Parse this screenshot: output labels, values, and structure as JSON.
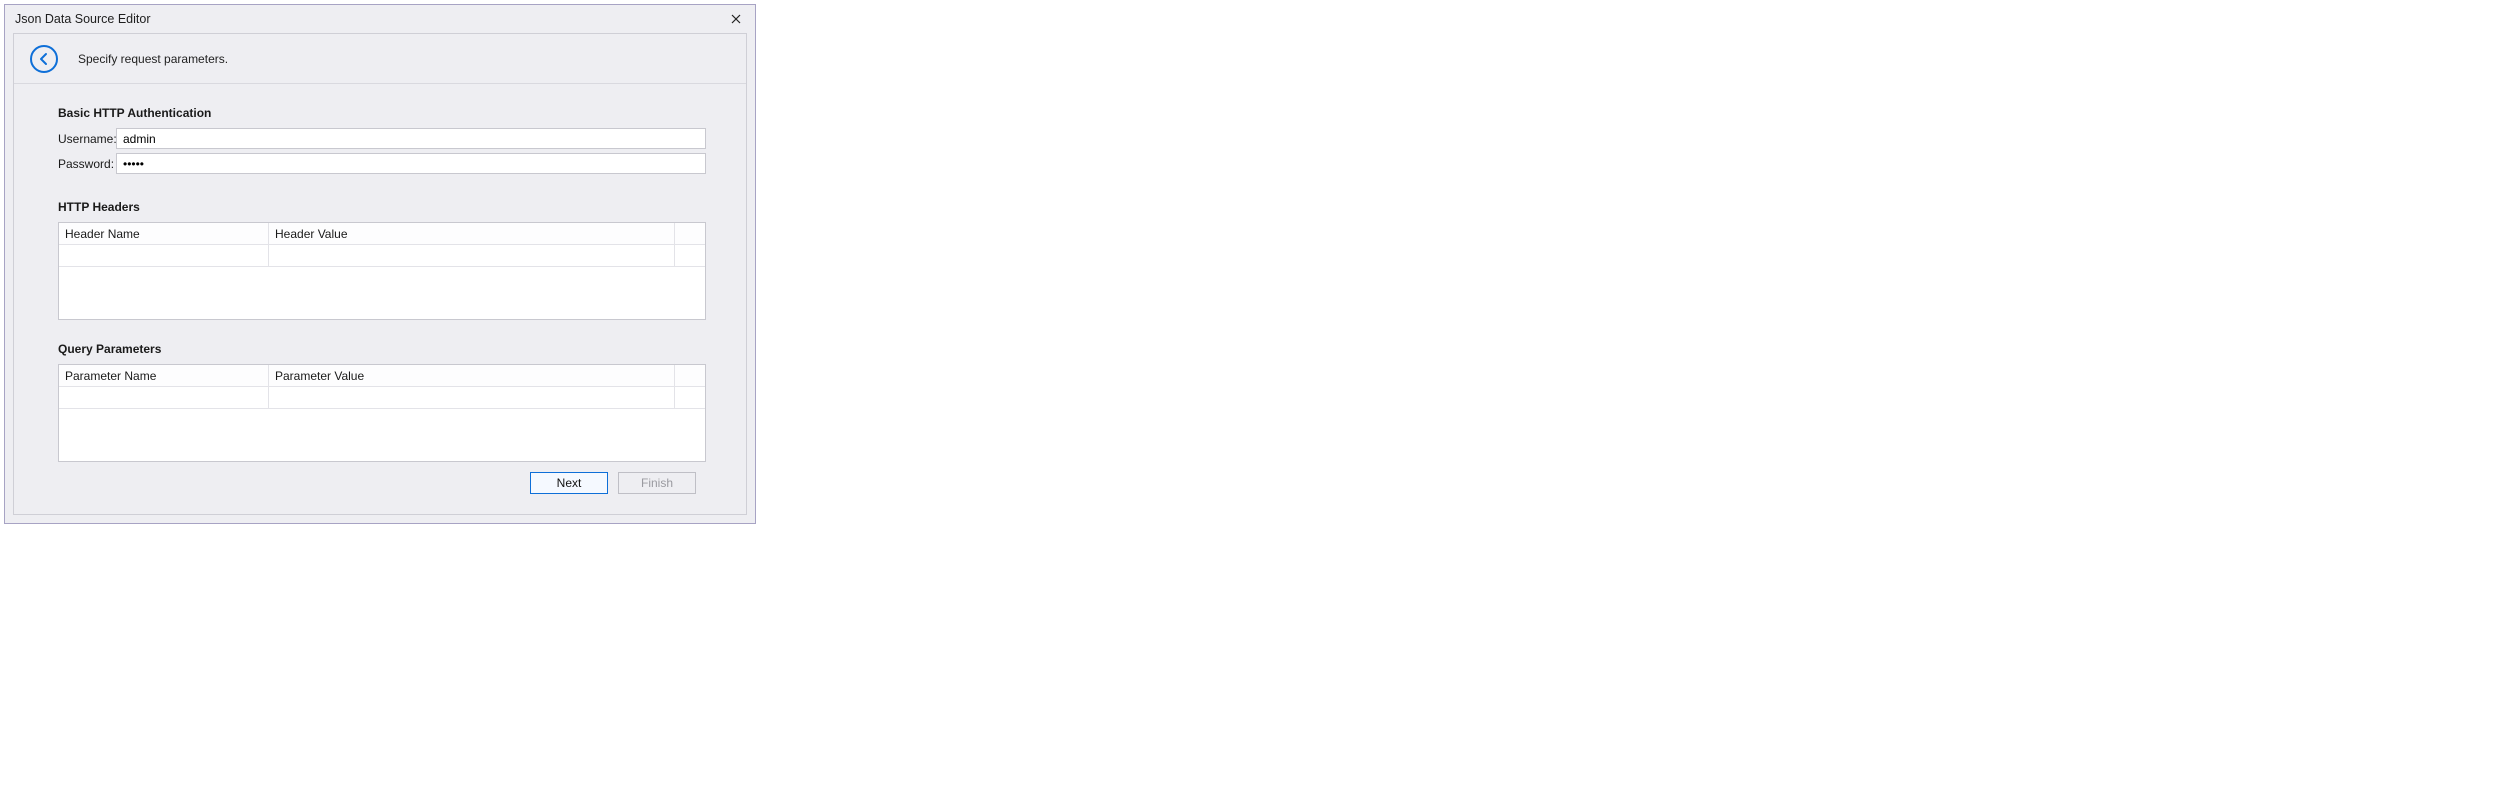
{
  "window": {
    "title": "Json Data Source Editor"
  },
  "header": {
    "subtitle": "Specify request parameters."
  },
  "auth": {
    "section_title": "Basic HTTP Authentication",
    "username_label": "Username:",
    "username_value": "admin",
    "password_label": "Password:",
    "password_value": "•••••"
  },
  "headers": {
    "section_title": "HTTP Headers",
    "col_name": "Header Name",
    "col_value": "Header Value",
    "rows": [
      {
        "name": "",
        "value": ""
      }
    ]
  },
  "query": {
    "section_title": "Query Parameters",
    "col_name": "Parameter Name",
    "col_value": "Parameter Value",
    "rows": [
      {
        "name": "",
        "value": ""
      }
    ]
  },
  "buttons": {
    "next": "Next",
    "finish": "Finish"
  }
}
